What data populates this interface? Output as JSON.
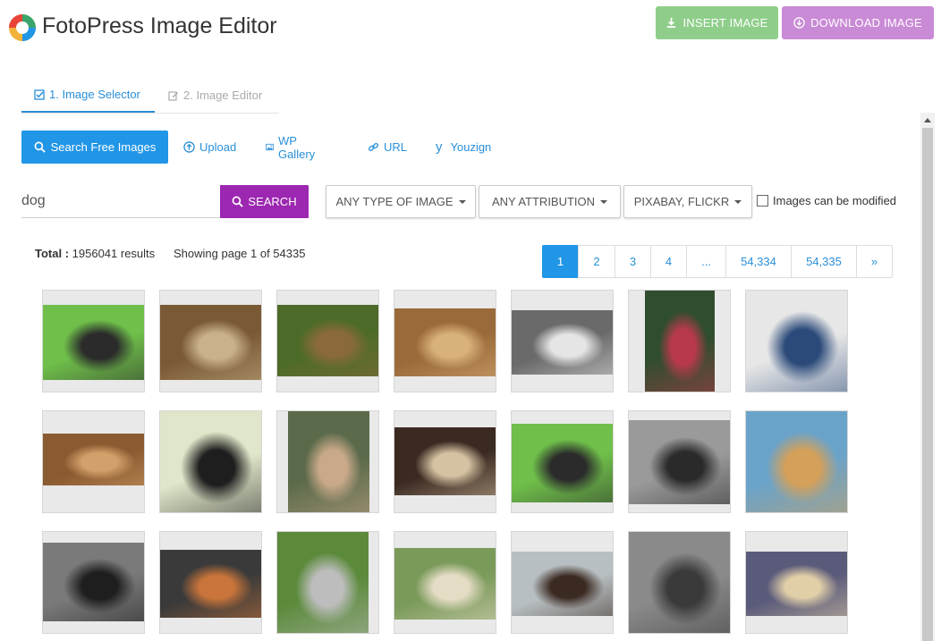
{
  "header": {
    "title": "FotoPress Image Editor",
    "insert_label": "INSERT IMAGE",
    "download_label": "DOWNLOAD IMAGE",
    "colors": {
      "insert": "#8fce8a",
      "download": "#c98ad6"
    }
  },
  "tabs": [
    {
      "label": "1. Image Selector",
      "active": true
    },
    {
      "label": "2. Image Editor",
      "active": false
    }
  ],
  "sources": {
    "active_label": "Search Free Images",
    "links": [
      {
        "label": "Upload",
        "icon": "upload-icon"
      },
      {
        "label": "WP Gallery",
        "icon": "image-icon"
      },
      {
        "label": "URL",
        "icon": "link-icon"
      },
      {
        "label": "Youzign",
        "icon": "youzign-icon"
      }
    ]
  },
  "search": {
    "query": "dog",
    "button_label": "SEARCH",
    "filters": [
      "ANY TYPE OF IMAGE",
      "ANY ATTRIBUTION",
      "PIXABAY, FLICKR"
    ],
    "modified_label": "Images can be modified",
    "modified_checked": false
  },
  "results": {
    "total_label": "Total :",
    "total_value": "1956041 results",
    "showing": "Showing page 1 of 54335"
  },
  "pagination": [
    "1",
    "2",
    "3",
    "4",
    "...",
    "54,334",
    "54,335",
    "»"
  ],
  "thumbnails": [
    {
      "name": "puppy-on-grass",
      "palette": [
        "#6fbf4a",
        "#2b2b2b"
      ]
    },
    {
      "name": "yorkie-lying",
      "palette": [
        "#7a5a35",
        "#c9b28a"
      ]
    },
    {
      "name": "yorkie-garden",
      "palette": [
        "#4d6b28",
        "#8a6a3a"
      ]
    },
    {
      "name": "yorkie-closeup",
      "palette": [
        "#9b6a3a",
        "#d9b27a"
      ]
    },
    {
      "name": "bw-dog-fence",
      "palette": [
        "#6a6a6a",
        "#e5e5e5"
      ]
    },
    {
      "name": "dog-with-cape",
      "palette": [
        "#2f4d2f",
        "#b83a4a"
      ]
    },
    {
      "name": "girl-with-husky",
      "palette": [
        "#e7e7e7",
        "#2b4a7a"
      ]
    },
    {
      "name": "yorkie-lying-2",
      "palette": [
        "#8a5a30",
        "#d2a06a"
      ]
    },
    {
      "name": "bernese-dog",
      "palette": [
        "#dfe6c9",
        "#1e1e1e"
      ]
    },
    {
      "name": "soldier-with-dog",
      "palette": [
        "#5a6a4a",
        "#c9a98a"
      ]
    },
    {
      "name": "pug-on-floor",
      "palette": [
        "#3b2a22",
        "#d6c2a2"
      ]
    },
    {
      "name": "puppy-grass-2",
      "palette": [
        "#6fbf4a",
        "#2b2b2b"
      ]
    },
    {
      "name": "bw-beach-dog",
      "palette": [
        "#9a9a9a",
        "#2a2a2a"
      ]
    },
    {
      "name": "chihuahua",
      "palette": [
        "#6aa3c9",
        "#d4a05a"
      ]
    },
    {
      "name": "bw-woman-cafe",
      "palette": [
        "#7a7a7a",
        "#1e1e1e"
      ]
    },
    {
      "name": "papillon",
      "palette": [
        "#3a3a3a",
        "#c8743a"
      ]
    },
    {
      "name": "schnauzer",
      "palette": [
        "#5b8a3a",
        "#bdbdbd"
      ]
    },
    {
      "name": "two-retrievers",
      "palette": [
        "#7a9a5a",
        "#e5dcc6"
      ]
    },
    {
      "name": "dog-profile",
      "palette": [
        "#b8bfc2",
        "#3b2a22"
      ]
    },
    {
      "name": "bw-dog-portrait",
      "palette": [
        "#8a8a8a",
        "#3a3a3a"
      ]
    },
    {
      "name": "running-dog",
      "palette": [
        "#5a5a7a",
        "#e1cfa8"
      ]
    }
  ]
}
